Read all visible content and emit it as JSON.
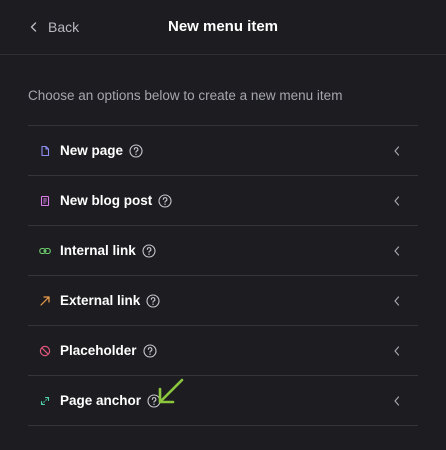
{
  "header": {
    "back_label": "Back",
    "title": "New menu item"
  },
  "intro": "Choose an options below to create a new menu item",
  "items": [
    {
      "label": "New page",
      "icon": "page-icon",
      "color": "#8f8ff2"
    },
    {
      "label": "New blog post",
      "icon": "blog-post-icon",
      "color": "#d97ee8"
    },
    {
      "label": "Internal link",
      "icon": "link-icon",
      "color": "#6fd36f"
    },
    {
      "label": "External link",
      "icon": "external-arrow-icon",
      "color": "#f0a04a"
    },
    {
      "label": "Placeholder",
      "icon": "prohibited-icon",
      "color": "#e0577a"
    },
    {
      "label": "Page anchor",
      "icon": "anchor-arrows-icon",
      "color": "#4fd1a5"
    }
  ],
  "colors": {
    "background": "#1c1c21",
    "divider": "#34343b",
    "muted_text": "#a6a6ae",
    "annotation_arrow": "#8cc63f"
  }
}
